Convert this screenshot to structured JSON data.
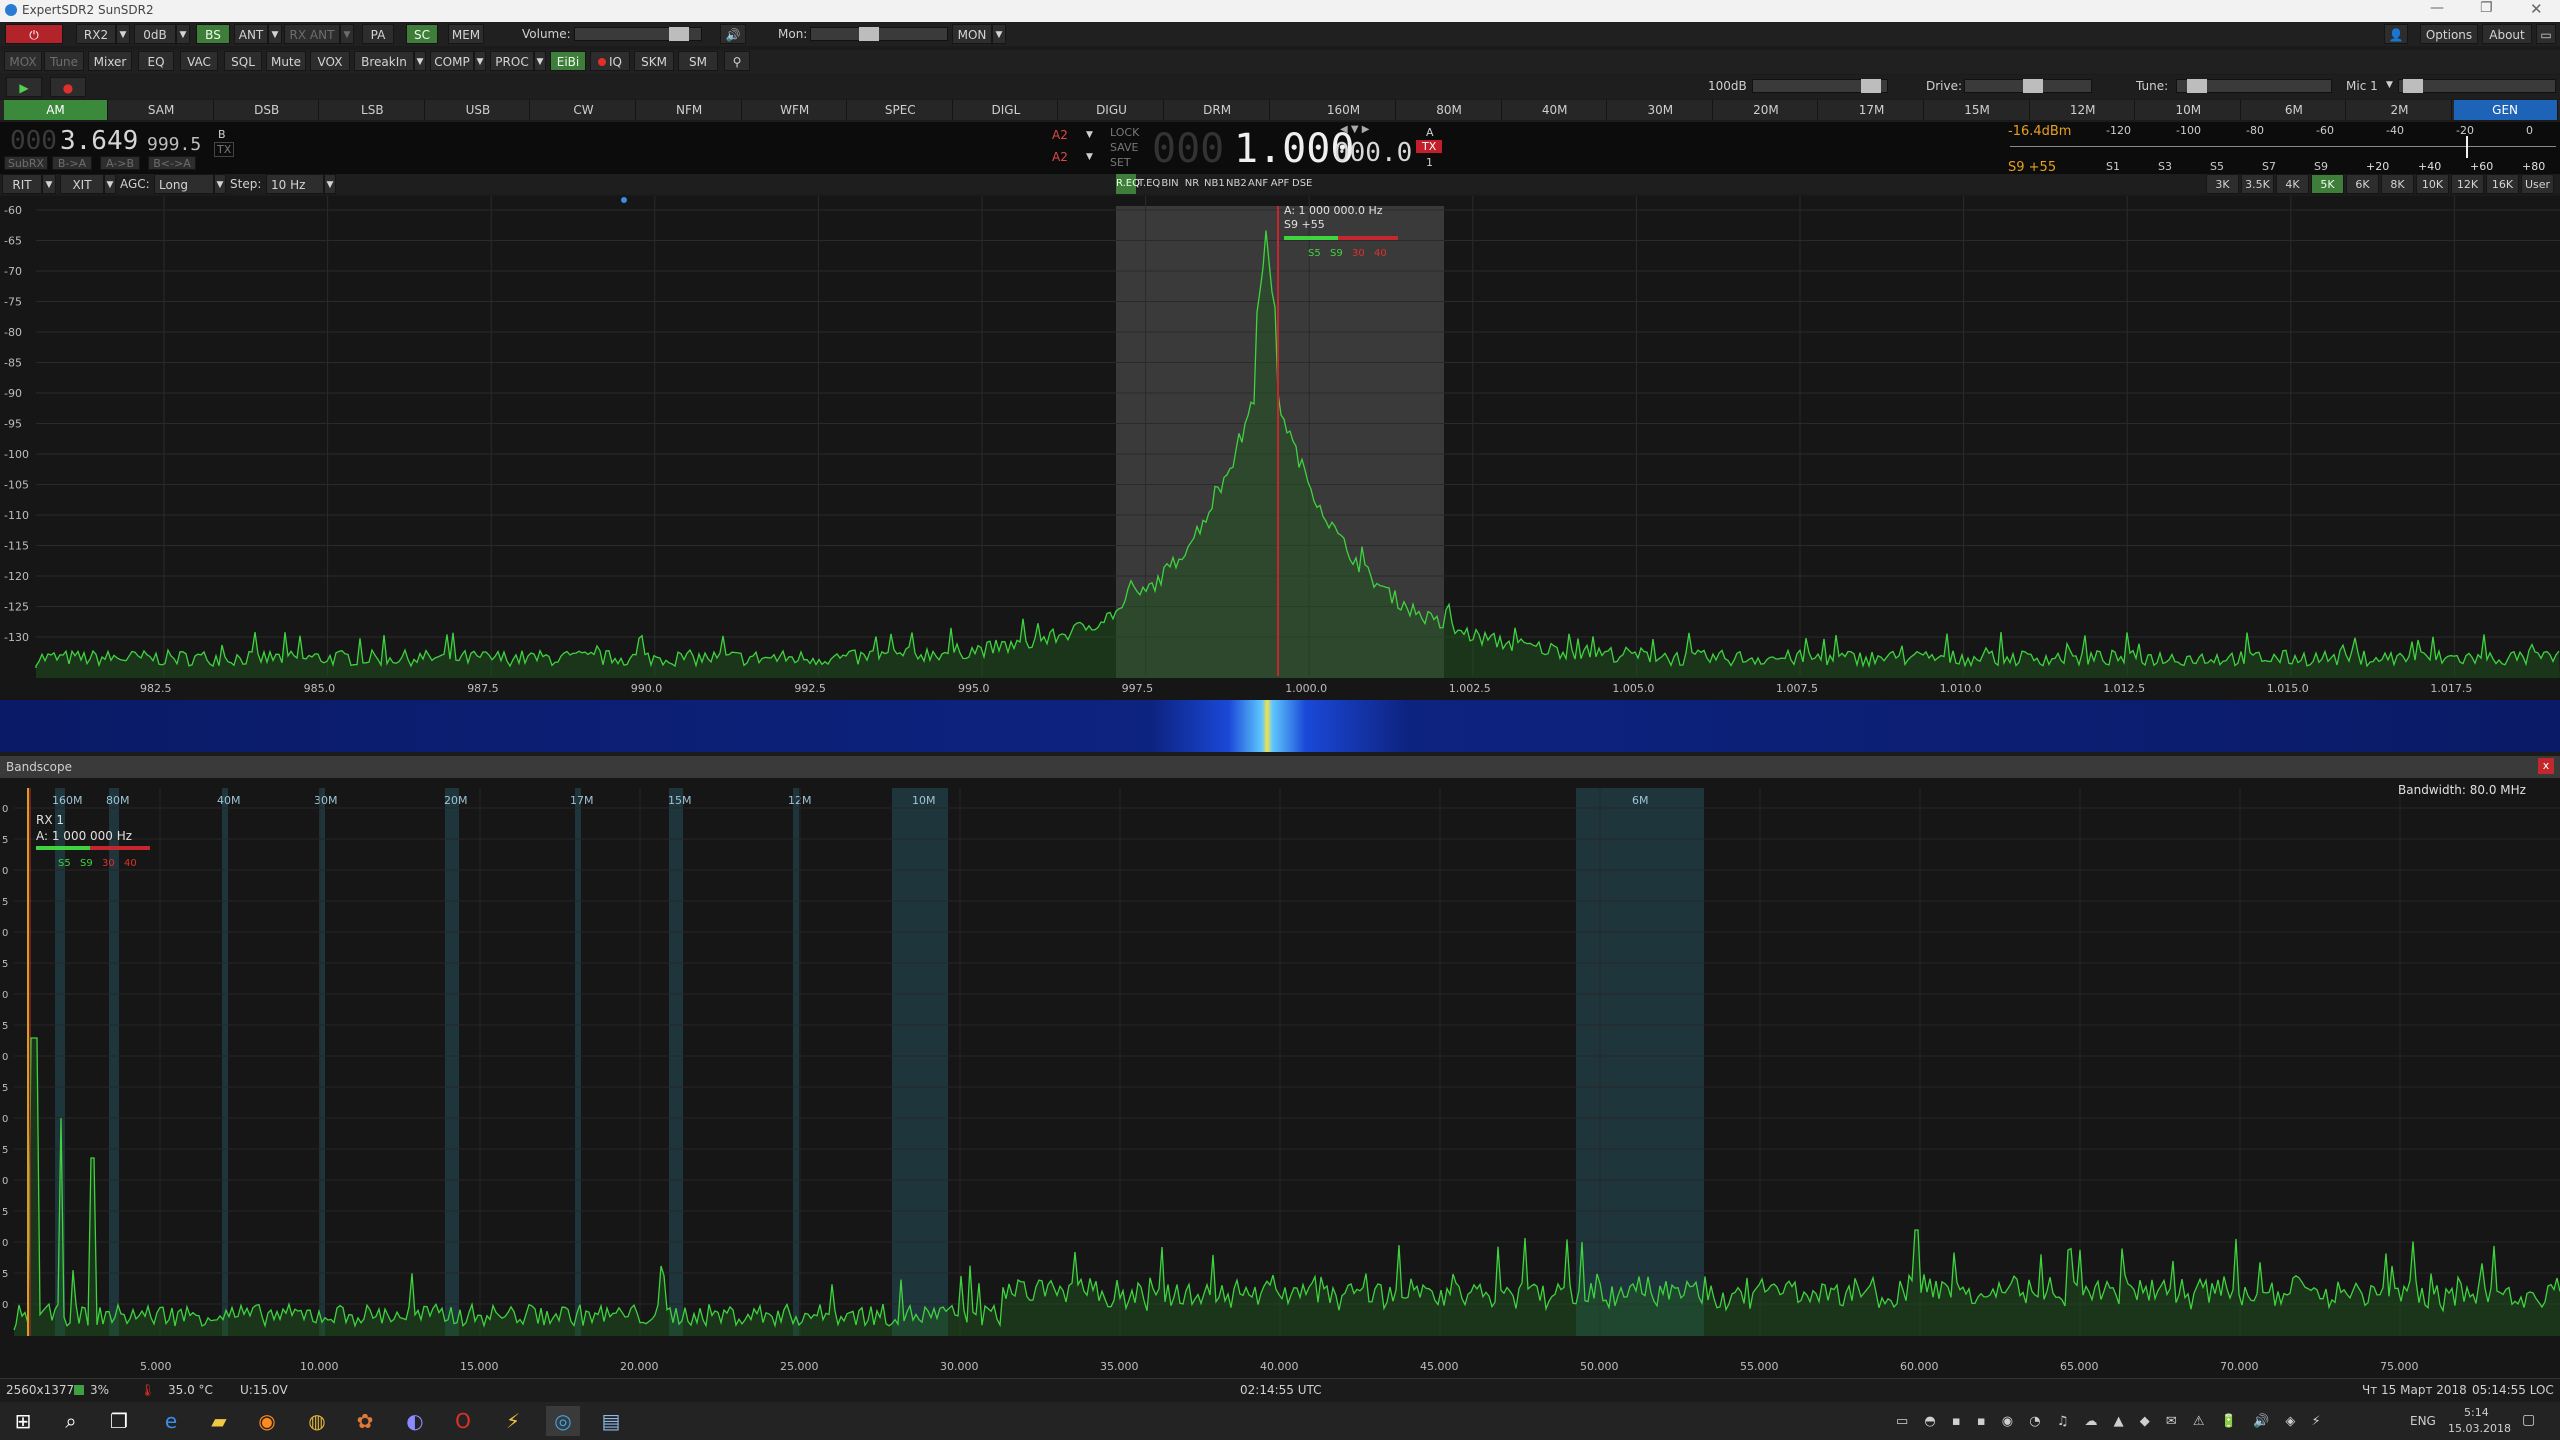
{
  "window": {
    "title": "ExpertSDR2 SunSDR2"
  },
  "toolbar1": {
    "rx": "RX2",
    "att": "0dB",
    "bs": "BS",
    "ant": "ANT",
    "rx_ant": "RX ANT",
    "pa": "PA",
    "sc": "SC",
    "mem": "MEM",
    "volume_label": "Volume:",
    "mon_label": "Mon:",
    "mon_btn": "MON",
    "options": "Options",
    "about": "About"
  },
  "toolbar2": {
    "items": [
      "MOX",
      "Tune",
      "Mixer",
      "EQ",
      "VAC",
      "SQL",
      "Mute",
      "VOX",
      "BreakIn",
      "COMP",
      "PROC",
      "EiBi",
      "IQ",
      "SKM",
      "SM"
    ]
  },
  "levels": {
    "drv_level": "100dB",
    "drive_label": "Drive:",
    "tune_label": "Tune:",
    "mic_label": "Mic 1"
  },
  "modes": [
    "AM",
    "SAM",
    "DSB",
    "LSB",
    "USB",
    "CW",
    "NFM",
    "WFM",
    "SPEC",
    "DIGL",
    "DIGU",
    "DRM"
  ],
  "bands": [
    "160M",
    "80M",
    "40M",
    "30M",
    "20M",
    "17M",
    "15M",
    "12M",
    "10M",
    "6M",
    "2M",
    "GEN"
  ],
  "vfo": {
    "b_dim": "000",
    "b_main": "3.649",
    "b_sub": "999.5",
    "b_label": "B",
    "tx": "TX",
    "subrx": "SubRX",
    "b_to_a": "B->A",
    "a_to_b": "A->B",
    "swap": "B<->A",
    "ant_a": "A2",
    "ant_b": "A2",
    "lock": "LOCK",
    "save": "SAVE",
    "set": "SET",
    "a_dim": "000",
    "a_main": "1.000",
    "a_sub": "000.0",
    "a_label": "A",
    "a_tx": "TX",
    "a_num": "1"
  },
  "smeter": {
    "dbm": "-16.4dBm",
    "reading": "S9 +55",
    "top_scale": [
      "-120",
      "-100",
      "-80",
      "-60",
      "-40",
      "-20",
      "0"
    ],
    "bottom_scale": [
      "S1",
      "S3",
      "S5",
      "S7",
      "S9",
      "+20",
      "+40",
      "+60",
      "+80"
    ]
  },
  "rit_bar": {
    "rit": "RIT",
    "xit": "XIT",
    "agc_label": "AGC:",
    "agc": "Long",
    "step_label": "Step:",
    "step": "10 Hz",
    "dsp": [
      "R.EQ",
      "T.EQ",
      "BIN",
      "NR",
      "NB1",
      "NB2",
      "ANF",
      "APF",
      "DSE"
    ],
    "filters": [
      "3K",
      "3.5K",
      "4K",
      "5K",
      "6K",
      "8K",
      "10K",
      "12K",
      "16K",
      "User"
    ]
  },
  "panadapter": {
    "db_scale": [
      "-60",
      "-65",
      "-70",
      "-75",
      "-80",
      "-85",
      "-90",
      "-95",
      "-100",
      "-105",
      "-110",
      "-115",
      "-120",
      "-125",
      "-130"
    ],
    "freq_scale": [
      "982.5",
      "985.0",
      "987.5",
      "990.0",
      "992.5",
      "995.0",
      "997.5",
      "1.000.0",
      "1.002.5",
      "1.005.0",
      "1.007.5",
      "1.010.0",
      "1.012.5",
      "1.015.0",
      "1.017.5"
    ],
    "marker_freq": "A: 1 000 000.0 Hz",
    "marker_s": "S9 +55",
    "mini_scale": [
      "S5",
      "S9",
      "30",
      "40"
    ]
  },
  "bandscope": {
    "title": "Bandscope",
    "close": "x",
    "bandwidth": "Bandwidth: 80.0 MHz",
    "rx": "RX 1",
    "vfo": "A: 1 000 000 Hz",
    "mini_scale": [
      "S5",
      "S9",
      "30",
      "40"
    ],
    "band_labels": [
      "160M",
      "80M",
      "40M",
      "30M",
      "20M",
      "17M",
      "15M",
      "12M",
      "10M",
      "6M"
    ],
    "y_scale": [
      "0",
      "5",
      "0",
      "5",
      "0",
      "5",
      "0",
      "5",
      "0",
      "5",
      "0",
      "5",
      "0",
      "5",
      "0",
      "5",
      "0"
    ],
    "x_scale": [
      "5.000",
      "10.000",
      "15.000",
      "20.000",
      "25.000",
      "30.000",
      "35.000",
      "40.000",
      "45.000",
      "50.000",
      "55.000",
      "60.000",
      "65.000",
      "70.000",
      "75.000"
    ]
  },
  "statusbar": {
    "res": "2560x1377",
    "cpu": "3%",
    "temp": "35.0 °C",
    "volt": "U:15.0V",
    "utc": "02:14:55 UTC",
    "date_loc": "Чт 15 Март 2018",
    "loc_time": "05:14:55 LOC"
  },
  "taskbar": {
    "lang": "ENG",
    "time": "5:14",
    "date": "15.03.2018"
  }
}
